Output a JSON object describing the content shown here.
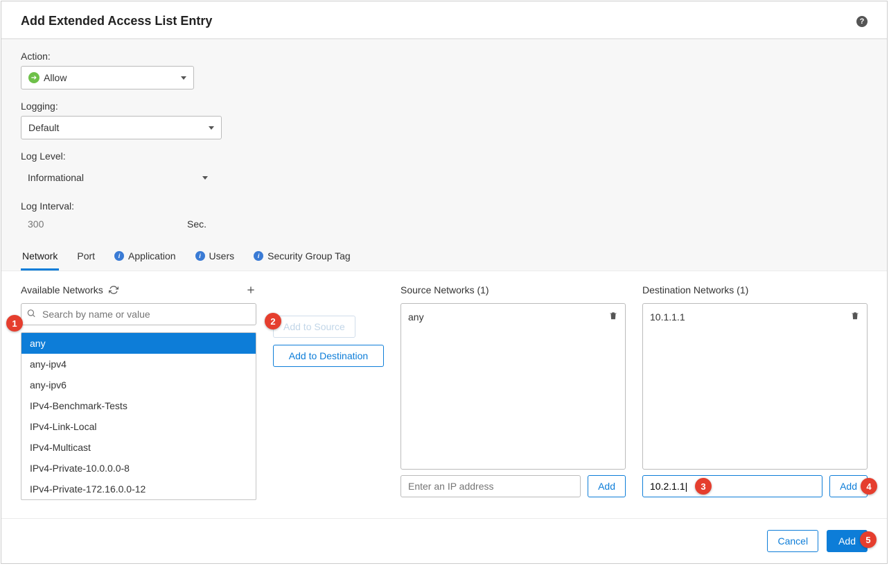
{
  "header": {
    "title": "Add Extended Access List Entry"
  },
  "form": {
    "action_label": "Action:",
    "action_value": "Allow",
    "logging_label": "Logging:",
    "logging_value": "Default",
    "log_level_label": "Log Level:",
    "log_level_value": "Informational",
    "log_interval_label": "Log Interval:",
    "log_interval_value": "300",
    "log_interval_unit": "Sec."
  },
  "tabs": {
    "network": "Network",
    "port": "Port",
    "application": "Application",
    "users": "Users",
    "sgt": "Security Group Tag"
  },
  "available": {
    "title": "Available Networks",
    "search_placeholder": "Search by name or value",
    "items": [
      "any",
      "any-ipv4",
      "any-ipv6",
      "IPv4-Benchmark-Tests",
      "IPv4-Link-Local",
      "IPv4-Multicast",
      "IPv4-Private-10.0.0.0-8",
      "IPv4-Private-172.16.0.0-12"
    ],
    "selected": "any"
  },
  "buttons": {
    "add_source": "Add to Source",
    "add_destination": "Add to Destination",
    "add": "Add",
    "cancel": "Cancel"
  },
  "source": {
    "title": "Source Networks (1)",
    "items": [
      "any"
    ],
    "ip_placeholder": "Enter an IP address",
    "ip_value": ""
  },
  "destination": {
    "title": "Destination Networks (1)",
    "items": [
      "10.1.1.1"
    ],
    "ip_placeholder": "",
    "ip_value": "10.2.1.1"
  },
  "annotations": {
    "b1": "1",
    "b2": "2",
    "b3": "3",
    "b4": "4",
    "b5": "5"
  }
}
